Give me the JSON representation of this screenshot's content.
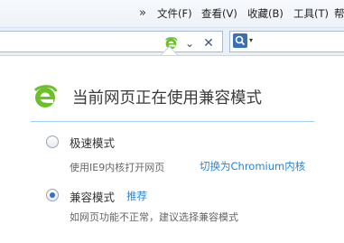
{
  "menubar": {
    "more_glyph": "»",
    "items": [
      "文件(F)",
      "查看(V)",
      "收藏(B)",
      "工具(T)",
      "帮"
    ]
  },
  "addressbar": {
    "ie_icon": "ie-logo-icon",
    "dropdown_glyph": "⌄",
    "close_glyph": "✕"
  },
  "searchbar": {
    "dropdown_glyph": "▾"
  },
  "popup": {
    "title": "当前网页正在使用兼容模式",
    "options": [
      {
        "label": "极速模式",
        "description": "使用IE9内核打开网页",
        "action": "切换为Chromium内核",
        "selected": false
      },
      {
        "label": "兼容模式",
        "badge": "推荐",
        "description": "如网页功能不正常，建议选择兼容模式",
        "selected": true
      }
    ]
  },
  "colors": {
    "accent": "#2a83d2",
    "ie_green": "#6cc12b",
    "separator": "#9fd0ef"
  }
}
